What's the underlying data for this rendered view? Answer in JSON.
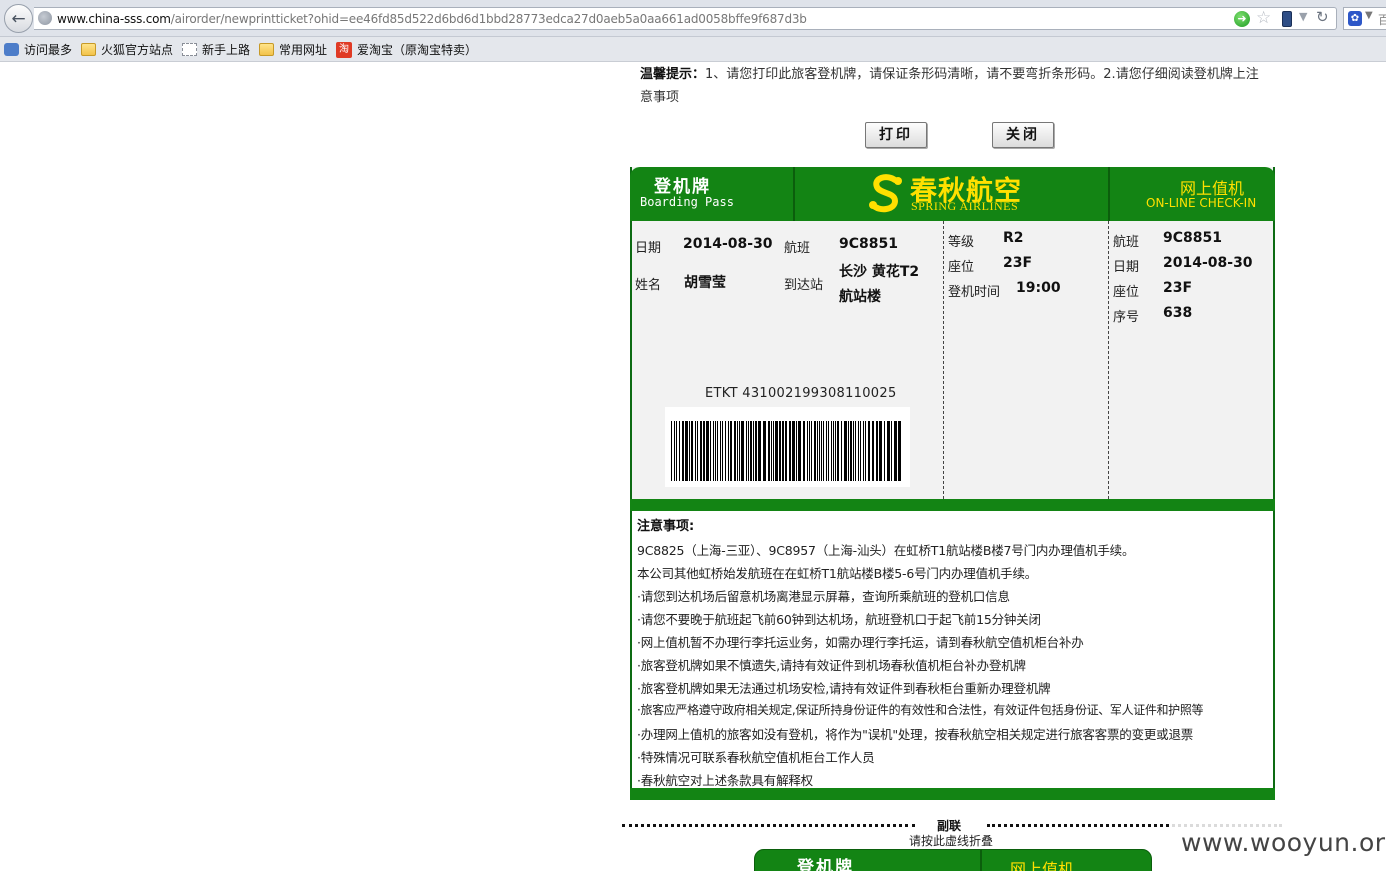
{
  "browser": {
    "url_domain": "www.china-sss.com",
    "url_path": "/airorder/newprintticket?ohid=ee46fd85d522d6bd6d1bbd28773edca27d0aeb5a0aa661ad0058bffe9f687d3b",
    "search_text": "百"
  },
  "bookmarks": [
    {
      "label": "访问最多",
      "icon": "gear-icon"
    },
    {
      "label": "火狐官方站点",
      "icon": "folder-icon"
    },
    {
      "label": "新手上路",
      "icon": "page-icon"
    },
    {
      "label": "常用网址",
      "icon": "folder-icon"
    },
    {
      "label": "爱淘宝（原淘宝特卖）",
      "icon": "taobao-icon",
      "icon_text": "淘"
    }
  ],
  "tip": {
    "label": "温馨提示：",
    "text": "1、请您打印此旅客登机牌，请保证条形码清晰，请不要弯折条形码。2.请您仔细阅读登机牌上注意事项"
  },
  "buttons": {
    "print": "打印",
    "close": "关闭"
  },
  "pass": {
    "title_cn": "登机牌",
    "title_en": "Boarding Pass",
    "airline_cn": "春秋航空",
    "airline_en": "SPRING  AIRLINES",
    "checkin_cn": "网上值机",
    "checkin_en": "ON-LINE  CHECK-IN",
    "main": {
      "date_label": "日期",
      "date": "2014-08-30",
      "flight_label": "航班",
      "flight": "9C8851",
      "name_label": "姓名",
      "name": "胡雪莹",
      "dest_label": "到达站",
      "dest_line1": "长沙 黄花T2",
      "dest_line2": "航站楼"
    },
    "middle": {
      "class_label": "等级",
      "class": "R2",
      "seat_label": "座位",
      "seat": "23F",
      "boarding_label": "登机时间",
      "boarding": "19:00"
    },
    "right": {
      "flight_label": "航班",
      "flight": "9C8851",
      "date_label": "日期",
      "date": "2014-08-30",
      "seat_label": "座位",
      "seat": "23F",
      "seq_label": "序号",
      "seq": "638"
    },
    "etkt": "ETKT  431002199308110025"
  },
  "notes": {
    "title": "注意事项:",
    "items": [
      "9C8825（上海-三亚）、9C8957（上海-汕头）在虹桥T1航站楼B楼7号门内办理值机手续。",
      "本公司其他虹桥始发航班在在虹桥T1航站楼B楼5-6号门内办理值机手续。",
      "·请您到达机场后留意机场离港显示屏幕，查询所乘航班的登机口信息",
      "·请您不要晚于航班起飞前60钟到达机场，航班登机口于起飞前15分钟关闭",
      "·网上值机暂不办理行李托运业务，如需办理行李托运，请到春秋航空值机柜台补办",
      "·旅客登机牌如果不慎遗失,请持有效证件到机场春秋值机柜台补办登机牌",
      "·旅客登机牌如果无法通过机场安检,请持有效证件到春秋柜台重新办理登机牌",
      "·旅客应严格遵守政府相关规定,保证所持身份证件的有效性和合法性，有效证件包括身份证、军人证件和护照等",
      "·办理网上值机的旅客如没有登机，将作为\"误机\"处理，按春秋航空相关规定进行旅客客票的变更或退票",
      "·特殊情况可联系春秋航空值机柜台工作人员",
      "·春秋航空对上述条款具有解释权"
    ]
  },
  "fold": {
    "label": "副联",
    "hint": "请按此虚线折叠"
  },
  "stub": {
    "title_cn": "登机牌",
    "checkin_cn": "网上值机"
  },
  "watermark": "www.wooyun.org",
  "colors": {
    "pass_green": "#138414",
    "logo_yellow": "#ffe000"
  }
}
